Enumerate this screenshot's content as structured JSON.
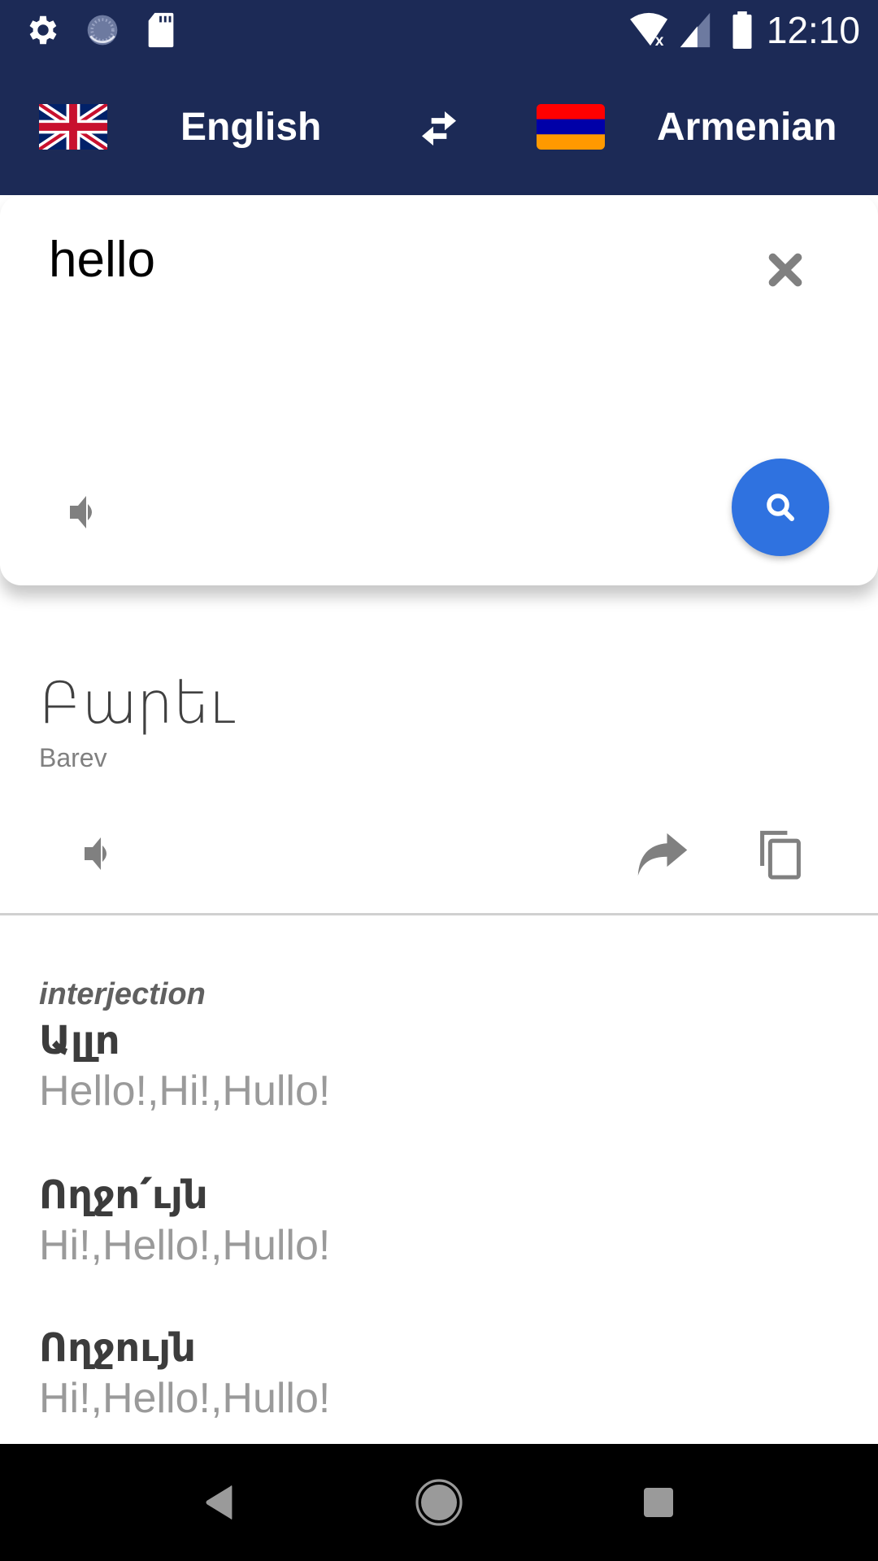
{
  "status_bar": {
    "time": "12:10",
    "left_icons": [
      "settings-icon",
      "sync-icon",
      "sd-card-icon"
    ],
    "right_icons": [
      "wifi-off-icon",
      "signal-icon",
      "battery-icon"
    ]
  },
  "header": {
    "source_language": "English",
    "target_language": "Armenian",
    "source_flag": "uk-flag-icon",
    "target_flag": "armenia-flag-icon",
    "swap_icon": "swap-icon"
  },
  "input_card": {
    "text": "hello",
    "clear_icon": "close-icon",
    "speak_icon": "speaker-icon",
    "search_icon": "search-icon"
  },
  "translation": {
    "word": "Բարեւ",
    "transliteration": "Barev",
    "actions": [
      "speaker-icon",
      "share-icon",
      "copy-icon"
    ]
  },
  "dictionary": {
    "part_of_speech": "interjection",
    "entries": [
      {
        "word": "Ալլո",
        "gloss": "Hello!,Hi!,Hullo!"
      },
      {
        "word": "Ողջո՛ւյն",
        "gloss": "Hi!,Hello!,Hullo!"
      },
      {
        "word": "Ողջույն",
        "gloss": "Hi!,Hello!,Hullo!"
      }
    ]
  },
  "colors": {
    "header_bg": "#1c2a56",
    "fab": "#2f72e0",
    "icon_gray": "#808080"
  }
}
